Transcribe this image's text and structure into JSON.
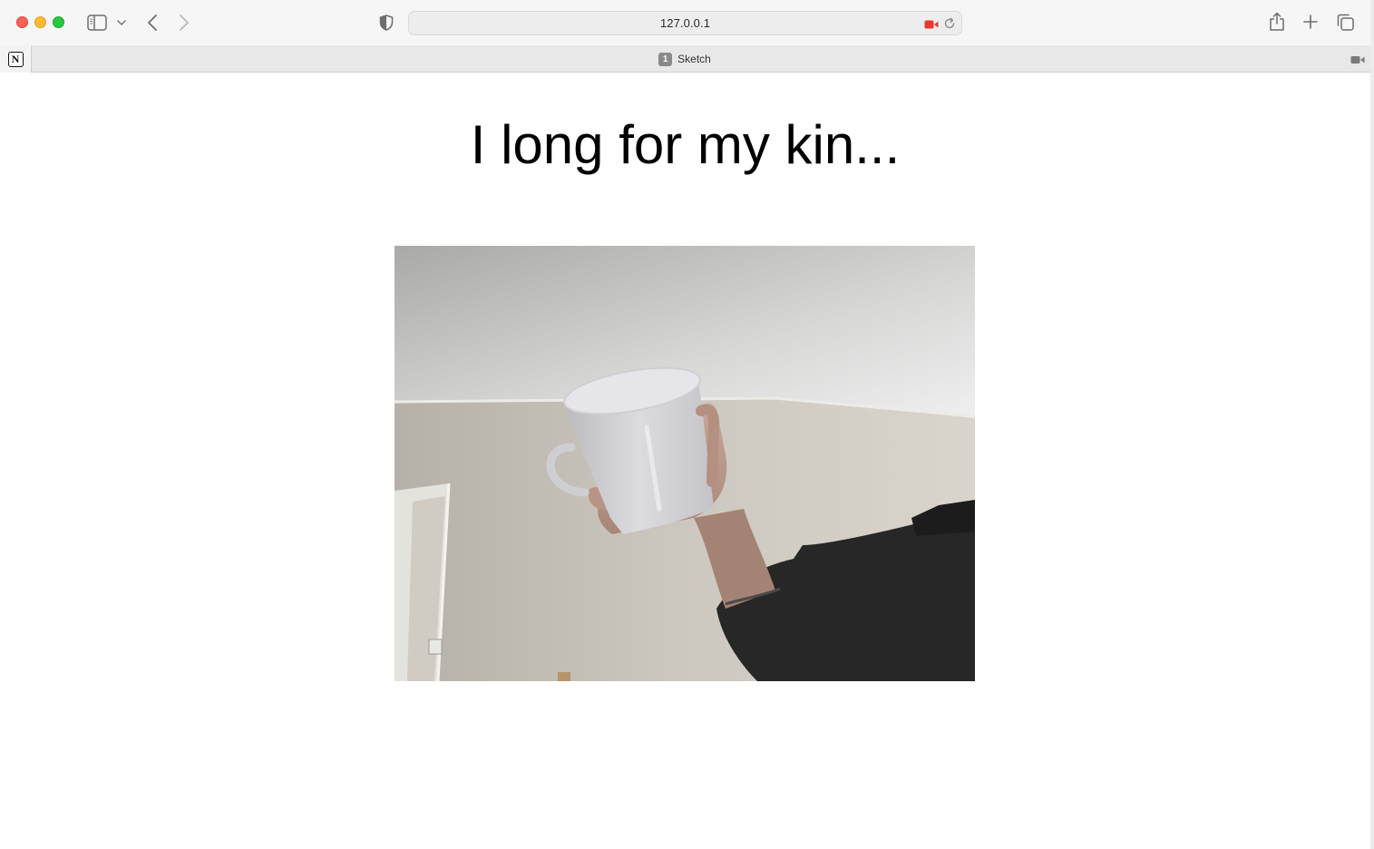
{
  "browser": {
    "address": "127.0.0.1",
    "tab": {
      "badge": "1",
      "title": "Sketch"
    },
    "pinned_tab_logo": "N",
    "icons": {
      "sidebar": "sidebar-icon",
      "sidebar_menu": "chevron-down-icon",
      "back": "chevron-left-icon",
      "forward": "chevron-right-icon",
      "privacy": "shield-icon",
      "camera_in_use": "video-camera-icon",
      "reload": "reload-icon",
      "share": "share-icon",
      "new_tab": "plus-icon",
      "tab_overview": "tab-overview-icon"
    },
    "colors": {
      "close": "#fe5f57",
      "minimize": "#febc2e",
      "maximize": "#28c840",
      "camera_indicator": "#e8382f"
    }
  },
  "page": {
    "heading": "I long for my kin..."
  }
}
